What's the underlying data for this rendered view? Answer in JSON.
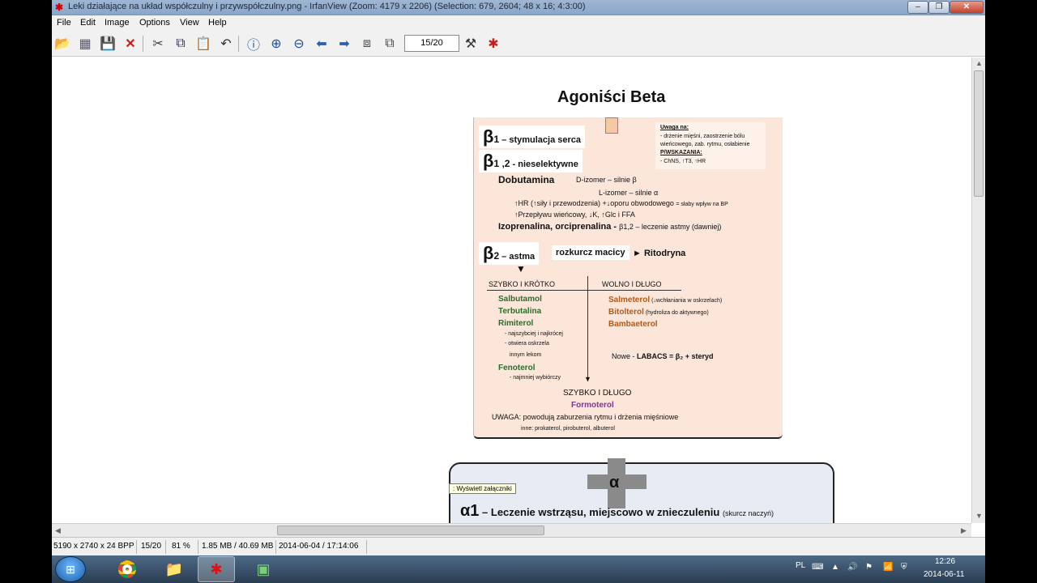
{
  "window": {
    "title": "Leki działające na układ współczulny i przywspółczulny.png - IrfanView (Zoom: 4179 x 2206) (Selection: 679, 2604; 48 x 16; 4:3:00)",
    "controls": {
      "minimize": "–",
      "maximize": "❐",
      "close": "✕"
    }
  },
  "menu": [
    "File",
    "Edit",
    "Image",
    "Options",
    "View",
    "Help"
  ],
  "toolbar": {
    "page_indicator": "15/20",
    "icons": [
      "open-folder",
      "thumbnails",
      "save",
      "delete",
      "cut",
      "copy",
      "paste",
      "undo",
      "info",
      "zoom-in",
      "zoom-out",
      "previous",
      "next",
      "first-page",
      "last-page",
      "properties",
      "settings"
    ]
  },
  "document": {
    "title": "Agoniści Beta",
    "slide": {
      "beta1": {
        "symbol": "β",
        "sub": "1",
        "text": " – stymulacja serca"
      },
      "beta12": {
        "symbol": "β",
        "sub": "1 ,2",
        "text": " - nieselektywne"
      },
      "note": {
        "heading": "Uwaga na:",
        "line1": "- drżenie mięśni, zaostrzenie bólu",
        "line2": "wieńcowego, zab. rytmu, osłabienie",
        "heading2": "P/WSKAZANIA:",
        "line3": "- ChNS, ↑T3, ↑HR"
      },
      "dobutamina": "Dobutamina",
      "d_izomer": "D-izomer – silnie  β",
      "l_izomer": "L-izomer – silnie  α",
      "hr_line": "↑HR (↑siły i przewodzenia) +↓oporu obwodowego",
      "hr_note": "= słaby wpływ na BP",
      "flow_line": "↑Przepływu wieńcowy, ↓K, ↑Glc i FFA",
      "izo_line_b": "Izoprenalina, orciprenalina - ",
      "izo_line_rest": "β1,2 – leczenie astmy (dawniej)",
      "beta2": {
        "symbol": "β",
        "sub": "2",
        "text": " – astma"
      },
      "uterus": "rozkurcz macicy",
      "ritodryna": "► Ritodryna",
      "fast_short": "SZYBKO I KRÓTKO",
      "slow_long": "WOLNO I DŁUGO",
      "salbutamol": "Salbutamol",
      "terbutalina": "Terbutalina",
      "rimiterol": "Rimiterol",
      "rim_1": "- najszybciej i najkrócej",
      "rim_2": "- otwiera oskrzela",
      "rim_3": "innym lekom",
      "fenoterol": "Fenoterol",
      "fen_1": "- najmniej wybiórczy",
      "salmeterol": "Salmeterol",
      "salm_note": " (↓wchłaniania w oskrzelach)",
      "bitolterol": "Bitolterol",
      "bit_note": " (hydroliza do aktywnego)",
      "bambaeterol": "Bambaeterol",
      "nowe": "Nowe -   ",
      "labacs": "LABACS = β₂ + steryd",
      "fast_long": "SZYBKO I DŁUGO",
      "formoterol": "Formoterol",
      "uwaga": "UWAGA: powodują zaburzenia rytmu i drżenia mięśniowe",
      "inne": "inne: prokaterol, pirobuterol, albuterol"
    },
    "slide2": {
      "alpha": "α",
      "tooltip": ": Wyświetl załączniki",
      "alpha1": "α1",
      "alpha1_text": " – Leczenie wstrząsu,  miejscowo w znieczuleniu ",
      "alpha1_note": "(skurcz naczyń)"
    }
  },
  "status": {
    "dimensions": "5190 x 2740 x 24 BPP",
    "page": "15/20",
    "zoom": "81 %",
    "size": "1.85 MB / 40.69 MB",
    "datetime": "2014-06-04 / 17:14:06"
  },
  "taskbar": {
    "language": "PL",
    "time": "12:26",
    "date": "2014-06-11",
    "apps": [
      "start-orb",
      "chrome",
      "file-explorer",
      "irfanview",
      "app"
    ]
  },
  "colors": {
    "slide_bg": "#fbe6d9",
    "green_drug": "#2d6b2d",
    "orange_drug": "#b05a1a",
    "purple_drug": "#7a3a8a"
  }
}
